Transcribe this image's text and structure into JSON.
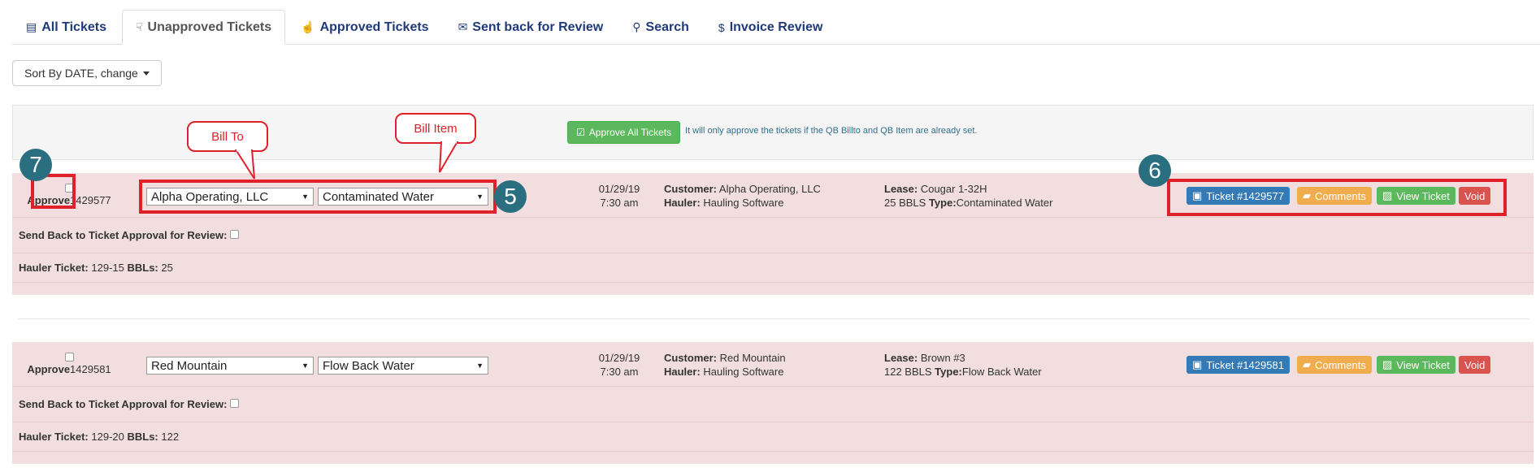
{
  "tabs": [
    {
      "label": "All Tickets",
      "icon": "list-icon",
      "glyph": "▤"
    },
    {
      "label": "Unapproved Tickets",
      "icon": "thumbs-down-icon",
      "glyph": "☟"
    },
    {
      "label": "Approved Tickets",
      "icon": "thumbs-up-icon",
      "glyph": "☝"
    },
    {
      "label": "Sent back for Review",
      "icon": "envelope-icon",
      "glyph": "✉"
    },
    {
      "label": "Search",
      "icon": "search-icon",
      "glyph": "⚲"
    },
    {
      "label": "Invoice Review",
      "icon": "dollar-icon",
      "glyph": "$"
    }
  ],
  "sort": {
    "label": "Sort By DATE, change"
  },
  "approve_all": {
    "label": "Approve All Tickets",
    "note": "It will only approve the tickets if the QB Billto and QB Item are already set."
  },
  "annotations": {
    "bill_to": "Bill To",
    "bill_item": "Bill Item",
    "badge_5": "5",
    "badge_6": "6",
    "badge_7": "7"
  },
  "tickets": [
    {
      "approve_label": "Approve",
      "id": "1429577",
      "bill_to": "Alpha Operating, LLC",
      "bill_item": "Contaminated Water",
      "date": "01/29/19",
      "time": "7:30 am",
      "customer_label": "Customer:",
      "customer": "Alpha Operating, LLC",
      "hauler_label": "Hauler:",
      "hauler": "Hauling Software",
      "lease_label": "Lease:",
      "lease": "Cougar 1-32H",
      "bbls_text": "25 BBLS",
      "type_label": "Type:",
      "type": "Contaminated Water",
      "ticket_btn": "Ticket #1429577",
      "comments_btn": "Comments",
      "view_btn": "View Ticket",
      "void_btn": "Void",
      "send_back_label": "Send Back to Ticket Approval for Review:",
      "hauler_ticket_label": "Hauler Ticket:",
      "hauler_ticket": "129-15",
      "bbls_label": "BBLs:",
      "bbls": "25"
    },
    {
      "approve_label": "Approve",
      "id": "1429581",
      "bill_to": "Red Mountain",
      "bill_item": "Flow Back Water",
      "date": "01/29/19",
      "time": "7:30 am",
      "customer_label": "Customer:",
      "customer": "Red Mountain",
      "hauler_label": "Hauler:",
      "hauler": "Hauling Software",
      "lease_label": "Lease:",
      "lease": "Brown #3",
      "bbls_text": "122 BBLS",
      "type_label": "Type:",
      "type": "Flow Back Water",
      "ticket_btn": "Ticket #1429581",
      "comments_btn": "Comments",
      "view_btn": "View Ticket",
      "void_btn": "Void",
      "send_back_label": "Send Back to Ticket Approval for Review:",
      "hauler_ticket_label": "Hauler Ticket:",
      "hauler_ticket": "129-20",
      "bbls_label": "BBLs:",
      "bbls": "122"
    }
  ]
}
